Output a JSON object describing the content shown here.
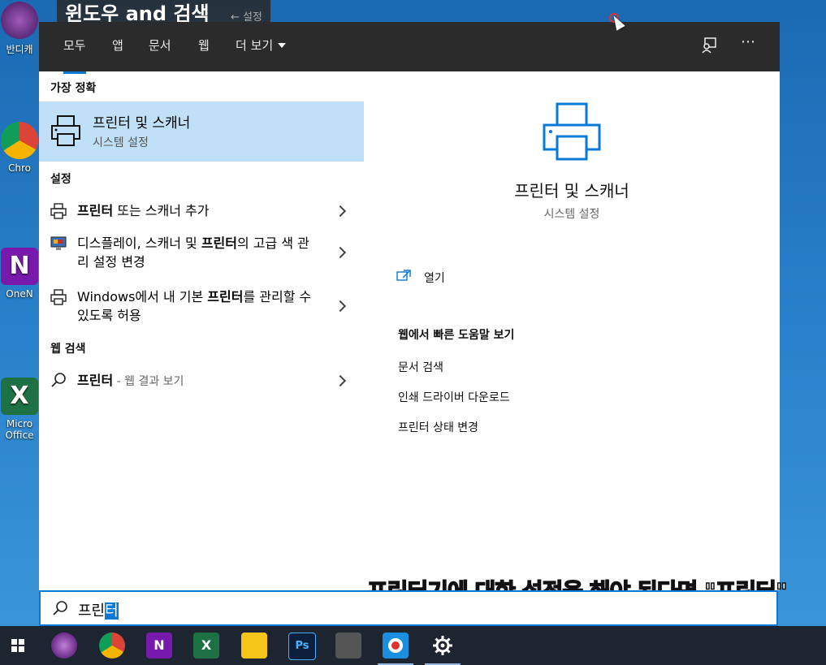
{
  "video_title": "윈도우 and 검색",
  "video_title_ghost": "←   설정",
  "desktop_icons": [
    {
      "label": "반디캐"
    },
    {
      "label": "Chro"
    },
    {
      "label": "OneN"
    },
    {
      "label": "Micro Office"
    }
  ],
  "tabs": {
    "all": "모두",
    "apps": "앱",
    "documents": "문서",
    "web": "웹",
    "more": "더 보기"
  },
  "top_icons": {
    "feedback": "feedback-icon",
    "more": "⋯"
  },
  "best_match": {
    "heading": "가장 정확",
    "title": "프린터 및 스캐너",
    "subtitle": "시스템 설정"
  },
  "settings_section": {
    "heading": "설정",
    "items": [
      {
        "bold": "프린터",
        "rest": " 또는 스캐너 추가"
      },
      {
        "pre": "디스플레이, 스캐너 및 ",
        "bold": "프린터",
        "rest": "의 고급 색 관리 설정 변경"
      },
      {
        "pre": "Windows에서 내 기본 ",
        "bold": "프린터",
        "rest": "를 관리할 수 있도록 허용"
      }
    ]
  },
  "web_section": {
    "heading": "웹 검색",
    "query": "프린터",
    "suffix": " - 웹 결과 보기"
  },
  "preview": {
    "title": "프린터 및 스캐너",
    "subtitle": "시스템 설정",
    "open_label": "열기",
    "web_heading": "웹에서 빠른 도움말 보기",
    "links": [
      "문서 검색",
      "인쇄 드라이버 다운로드",
      "프린터 상태 변경"
    ]
  },
  "search": {
    "typed": "프린",
    "selected": "터"
  },
  "caption": "프린터기에 대한 설정을 해야 된다면 \"프린터\"",
  "colors": {
    "accent": "#0a78d7",
    "highlight": "#bfe0f6",
    "topbar": "#2b2b2b",
    "taskbar": "#1c2530"
  },
  "taskbar_items": [
    "windows-start",
    "bandicam",
    "chrome",
    "onenote",
    "excel",
    "sticky-notes",
    "photoshop",
    "calculator",
    "bandicam-rec",
    "settings"
  ]
}
